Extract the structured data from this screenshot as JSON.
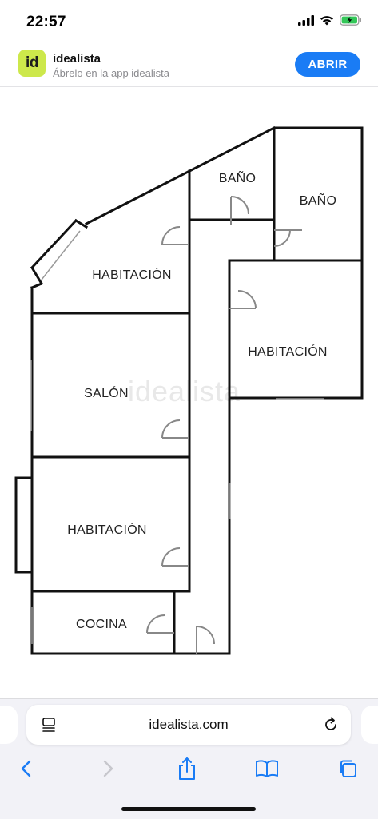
{
  "status_bar": {
    "time": "22:57",
    "icons": [
      "cellular-signal-icon",
      "wifi-icon",
      "battery-charging-icon"
    ]
  },
  "app_banner": {
    "logo_text": "id",
    "app_name": "idealista",
    "subtitle": "Ábrelo en la app idealista",
    "open_button": "ABRIR"
  },
  "floorplan": {
    "watermark": "idealista",
    "rooms": {
      "bano_1": "BAÑO",
      "bano_2": "BAÑO",
      "habitacion_1": "HABITACIÓN",
      "habitacion_2": "HABITACIÓN",
      "salon": "SALÓN",
      "habitacion_3": "HABITACIÓN",
      "cocina": "COCINA"
    }
  },
  "browser": {
    "url": "idealista.com",
    "toolbar": [
      "back-icon",
      "forward-icon",
      "share-icon",
      "bookmarks-icon",
      "tabs-icon"
    ]
  },
  "colors": {
    "accent": "#1a7cf5",
    "logo_bg": "#cde84b",
    "disabled": "#c7c7cc"
  }
}
